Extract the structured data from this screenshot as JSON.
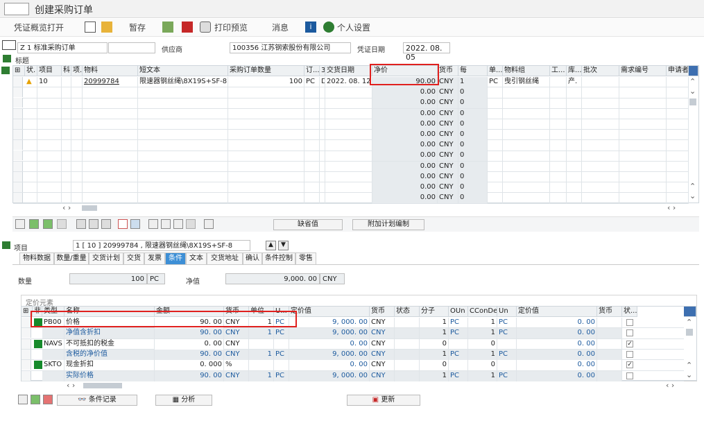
{
  "title": "创建采购订单",
  "toolbar": {
    "overview": "凭证概览打开",
    "hold": "暂存",
    "print_preview": "打印预览",
    "messages": "消息",
    "personal_settings": "个人设置"
  },
  "header": {
    "order_type": "Z 1 标准采购订单",
    "supplier_label": "供应商",
    "supplier_value": "100356 江苏钢索股份有限公司",
    "doc_date_label": "凭证日期",
    "doc_date_value": "2022. 08. 05",
    "title_label": "标题"
  },
  "items_table": {
    "columns": [
      "状.",
      "项目",
      "科",
      "项.",
      "物料",
      "短文本",
      "采购订单数量",
      "订...",
      "3",
      "交货日期",
      "净价",
      "货币",
      "每",
      "单...",
      "物料组",
      "工...",
      "库...",
      "批次",
      "需求编号",
      "申请者"
    ],
    "first_row": {
      "item": "10",
      "cat": "D",
      "material": "20999784",
      "short_text": "限速器钢丝绳\\8X19S+SF-8",
      "qty": "100",
      "unit": "PC",
      "delivery_date": "2022. 08. 12",
      "net_price": "90.00",
      "currency": "CNY",
      "per": "1",
      "order_unit": "PC",
      "material_group": "曳引钢丝绳",
      "storage": "产."
    },
    "empty_price": "0.00",
    "empty_currency": "CNY",
    "empty_per": "0"
  },
  "buttons": {
    "default_values": "缺省值",
    "additional_planning": "附加计划编制"
  },
  "item_detail": {
    "label": "项目",
    "selector": "1 [ 10 ] 20999784 , 限速器钢丝绳\\8X19S+SF-8",
    "tabs": [
      "物料数据",
      "数量/重量",
      "交货计划",
      "交货",
      "发票",
      "条件",
      "文本",
      "交货地址",
      "确认",
      "条件控制",
      "零售"
    ],
    "active_tab": "条件",
    "quantity_label": "数量",
    "quantity_value": "100",
    "quantity_unit": "PC",
    "net_label": "净值",
    "net_value": "9,000. 00",
    "net_currency": "CNY"
  },
  "pricing": {
    "title": "定价元素",
    "columns": [
      "非.",
      "类型",
      "名称",
      "金额",
      "货币",
      "单位",
      "U...",
      "定价值",
      "货币",
      "状态",
      "分子",
      "OUn",
      "CConDe",
      "Un",
      "定价值",
      "货币",
      "状..."
    ],
    "rows": [
      {
        "type": "PB00",
        "name": "价格",
        "amount": "90. 00",
        "currency": "CNY",
        "per": "1",
        "unit": "PC",
        "cond_value": "9, 000. 00",
        "cur2": "CNY",
        "num": "1",
        "oun": "PC",
        "cconde": "1",
        "un": "PC",
        "value2": "0. 00",
        "blue": false,
        "green": true,
        "check": ""
      },
      {
        "type": "",
        "name": "净值含折扣",
        "amount": "90. 00",
        "currency": "CNY",
        "per": "1",
        "unit": "PC",
        "cond_value": "9, 000. 00",
        "cur2": "CNY",
        "num": "1",
        "oun": "PC",
        "cconde": "1",
        "un": "PC",
        "value2": "0. 00",
        "blue": true,
        "green": false,
        "check": ""
      },
      {
        "type": "NAVS",
        "name": "不可抵扣的税金",
        "amount": "0. 00",
        "currency": "CNY",
        "per": "",
        "unit": "",
        "cond_value": "0. 00",
        "cur2": "CNY",
        "num": "0",
        "oun": "",
        "cconde": "0",
        "un": "",
        "value2": "0. 00",
        "blue": false,
        "green": true,
        "check": "✓"
      },
      {
        "type": "",
        "name": "含税的净价值",
        "amount": "90. 00",
        "currency": "CNY",
        "per": "1",
        "unit": "PC",
        "cond_value": "9, 000. 00",
        "cur2": "CNY",
        "num": "1",
        "oun": "PC",
        "cconde": "1",
        "un": "PC",
        "value2": "0. 00",
        "blue": true,
        "green": false,
        "check": ""
      },
      {
        "type": "SKTO",
        "name": "现金折扣",
        "amount": "0. 000",
        "currency": "%",
        "per": "",
        "unit": "",
        "cond_value": "0. 00",
        "cur2": "CNY",
        "num": "0",
        "oun": "",
        "cconde": "0",
        "un": "",
        "value2": "0. 00",
        "blue": false,
        "green": true,
        "check": "✓"
      },
      {
        "type": "",
        "name": "实际价格",
        "amount": "90. 00",
        "currency": "CNY",
        "per": "1",
        "unit": "PC",
        "cond_value": "9, 000. 00",
        "cur2": "CNY",
        "num": "1",
        "oun": "PC",
        "cconde": "1",
        "un": "PC",
        "value2": "0. 00",
        "blue": true,
        "green": false,
        "check": ""
      }
    ]
  },
  "bottom_buttons": {
    "condition_record": "条件记录",
    "analysis": "分析",
    "update": "更新"
  },
  "colors": {
    "highlight": "#e0201e",
    "active_tab": "#3d8fd6",
    "link_blue": "#1c5a9e",
    "status_green": "#168a2b"
  }
}
